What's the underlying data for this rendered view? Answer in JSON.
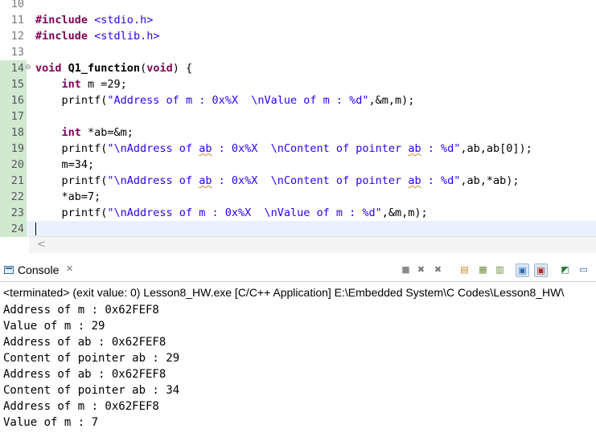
{
  "editor": {
    "lines": [
      {
        "num": "10",
        "text": ""
      },
      {
        "num": "11",
        "tokens": [
          [
            "kw",
            "#include"
          ],
          [
            "plain",
            " "
          ],
          [
            "str",
            "<stdio.h>"
          ]
        ]
      },
      {
        "num": "12",
        "tokens": [
          [
            "kw",
            "#include"
          ],
          [
            "plain",
            " "
          ],
          [
            "str",
            "<stdlib.h>"
          ]
        ]
      },
      {
        "num": "13",
        "text": ""
      },
      {
        "num": "14",
        "tokens": [
          [
            "kw",
            "void"
          ],
          [
            "plain",
            " "
          ],
          [
            "fn",
            "Q1_function"
          ],
          [
            "plain",
            "("
          ],
          [
            "kw",
            "void"
          ],
          [
            "plain",
            ") {"
          ]
        ]
      },
      {
        "num": "15",
        "tokens": [
          [
            "plain",
            "    "
          ],
          [
            "kw",
            "int"
          ],
          [
            "plain",
            " m =29;"
          ]
        ]
      },
      {
        "num": "16",
        "tokens": [
          [
            "plain",
            "    printf("
          ],
          [
            "str",
            "\"Address of m : 0x%X  \\nValue of m : %d\""
          ],
          [
            "plain",
            ",&m,m);"
          ]
        ]
      },
      {
        "num": "17",
        "text": ""
      },
      {
        "num": "18",
        "tokens": [
          [
            "plain",
            "    "
          ],
          [
            "kw",
            "int"
          ],
          [
            "plain",
            " *ab=&m;"
          ]
        ]
      },
      {
        "num": "19",
        "tokens": [
          [
            "plain",
            "    printf("
          ],
          [
            "str",
            "\"\\nAddress of "
          ],
          [
            "strsq",
            "ab"
          ],
          [
            "str",
            " : 0x%X  \\nContent of pointer "
          ],
          [
            "strsq",
            "ab"
          ],
          [
            "str",
            " : %d\""
          ],
          [
            "plain",
            ",ab,ab[0]);"
          ]
        ]
      },
      {
        "num": "20",
        "tokens": [
          [
            "plain",
            "    m=34;"
          ]
        ]
      },
      {
        "num": "21",
        "tokens": [
          [
            "plain",
            "    printf("
          ],
          [
            "str",
            "\"\\nAddress of "
          ],
          [
            "strsq",
            "ab"
          ],
          [
            "str",
            " : 0x%X  \\nContent of pointer "
          ],
          [
            "strsq",
            "ab"
          ],
          [
            "str",
            " : %d\""
          ],
          [
            "plain",
            ",ab,*ab);"
          ]
        ]
      },
      {
        "num": "22",
        "tokens": [
          [
            "plain",
            "    *ab=7;"
          ]
        ]
      },
      {
        "num": "23",
        "tokens": [
          [
            "plain",
            "    printf("
          ],
          [
            "str",
            "\"\\nAddress of m : 0x%X  \\nValue of m : %d\""
          ],
          [
            "plain",
            ",&m,m);"
          ]
        ]
      },
      {
        "num": "24",
        "text": ""
      }
    ],
    "scroll_arrow": "<"
  },
  "console": {
    "tab_label": "Console",
    "tab_close": "✕",
    "status": "<terminated> (exit value: 0) Lesson8_HW.exe [C/C++ Application] E:\\Embedded System\\C Codes\\Lesson8_HW\\",
    "toolbar": [
      {
        "name": "terminate-icon",
        "glyph": "■",
        "color": "#8a8a8a"
      },
      {
        "name": "remove-launch-icon",
        "glyph": "✖",
        "color": "#7a7a7a"
      },
      {
        "name": "remove-all-terminated-icon",
        "glyph": "✖",
        "color": "#7a7a7a"
      },
      {
        "name": "clear-console-icon",
        "glyph": "▤",
        "color": "#c08a2a"
      },
      {
        "name": "scroll-lock-icon",
        "glyph": "▦",
        "color": "#6a8a3a"
      },
      {
        "name": "word-wrap-icon",
        "glyph": "▥",
        "color": "#6a8a3a"
      },
      {
        "name": "show-stdout-icon",
        "glyph": "▣",
        "color": "#2a6ab0"
      },
      {
        "name": "show-stderr-icon",
        "glyph": "▣",
        "color": "#b02a2a"
      },
      {
        "name": "pin-console-icon",
        "glyph": "◩",
        "color": "#2a7a3a"
      },
      {
        "name": "display-console-icon",
        "glyph": "▭",
        "color": "#2a5a9a"
      }
    ],
    "output": [
      "Address of m : 0x62FEF8",
      "Value of m : 29",
      "Address of ab : 0x62FEF8",
      "Content of pointer ab : 29",
      "Address of ab : 0x62FEF8",
      "Content of pointer ab : 34",
      "Address of m : 0x62FEF8",
      "Value of m : 7"
    ]
  }
}
